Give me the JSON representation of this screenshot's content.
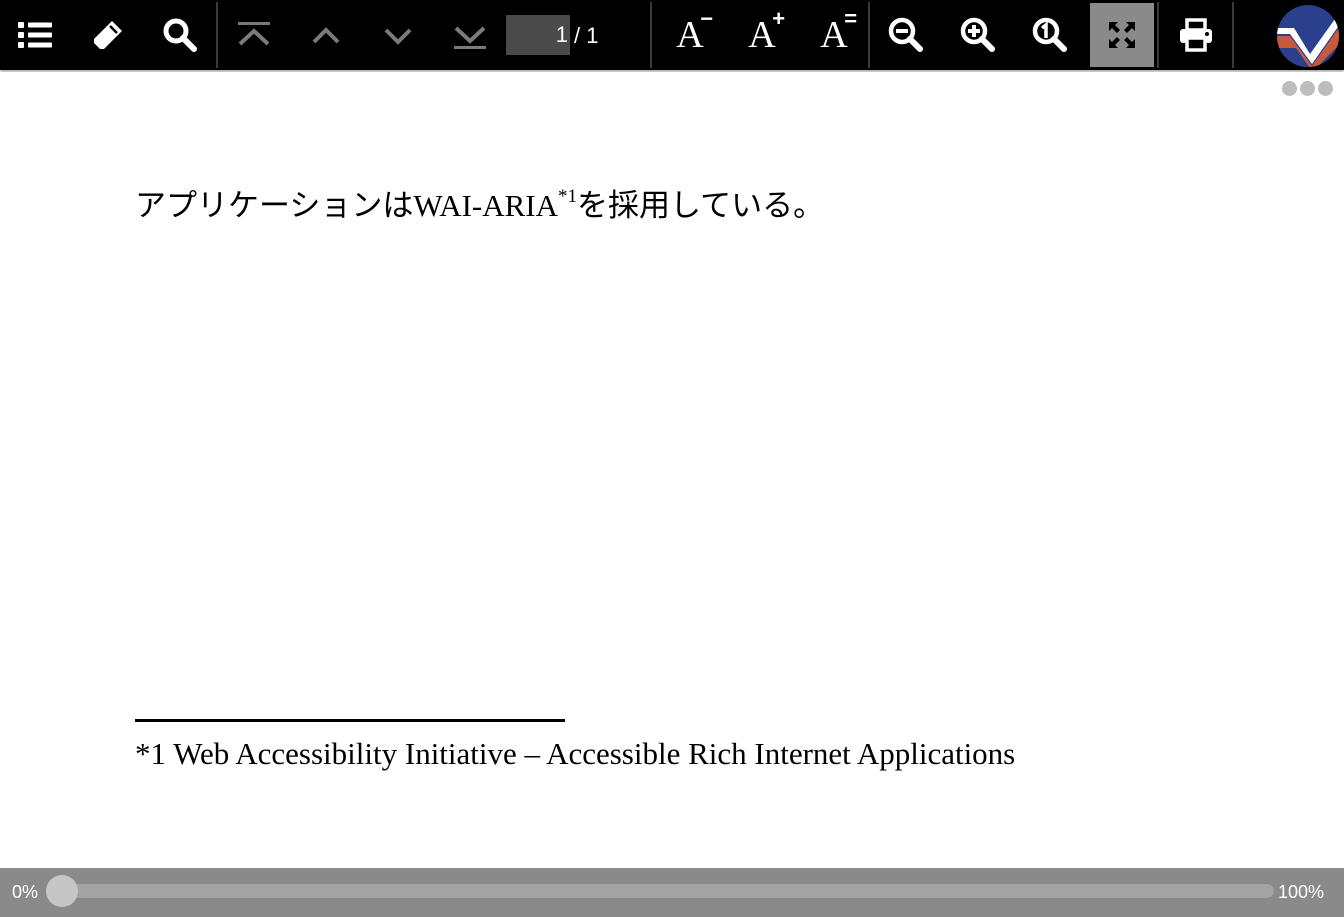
{
  "toolbar": {
    "buttons": [
      {
        "name": "table-of-contents",
        "icon": "list-icon"
      },
      {
        "name": "highlighter",
        "icon": "pencil-icon"
      },
      {
        "name": "search",
        "icon": "search-icon"
      },
      {
        "name": "first-page",
        "icon": "first-page-icon",
        "disabled": true
      },
      {
        "name": "previous-page",
        "icon": "chevron-up-icon",
        "disabled": true
      },
      {
        "name": "next-page",
        "icon": "chevron-down-icon",
        "disabled": true
      },
      {
        "name": "last-page",
        "icon": "last-page-icon",
        "disabled": true
      },
      {
        "name": "font-smaller",
        "icon": "font-decrease-icon",
        "label": "A",
        "sup": "−"
      },
      {
        "name": "font-larger",
        "icon": "font-increase-icon",
        "label": "A",
        "sup": "+"
      },
      {
        "name": "font-reset",
        "icon": "font-reset-icon",
        "label": "A",
        "sup": "="
      },
      {
        "name": "zoom-out",
        "icon": "zoom-out-icon"
      },
      {
        "name": "zoom-in",
        "icon": "zoom-in-icon"
      },
      {
        "name": "zoom-actual",
        "icon": "zoom-actual-size-icon"
      },
      {
        "name": "fit-page",
        "icon": "expand-icon",
        "active": true
      },
      {
        "name": "print",
        "icon": "printer-icon"
      }
    ],
    "page_current": "1",
    "page_total": "/ 1",
    "logo": "app-logo"
  },
  "document": {
    "text_before": "アプリケーションは",
    "text_latin": "WAI-ARIA",
    "footnote_ref": "*1",
    "text_after": "を採用している。",
    "footnote_text": "*1 Web Accessibility Initiative – Accessible Rich Internet Applications"
  },
  "progress": {
    "start_label": "0%",
    "end_label": "100%",
    "value": 0
  },
  "colors": {
    "toolbar_bg": "#000000",
    "icon_enabled": "#ffffff",
    "icon_disabled": "#7a7a7a",
    "active_bg": "#8a8a8a",
    "progress_bg": "#8a8a8a"
  }
}
